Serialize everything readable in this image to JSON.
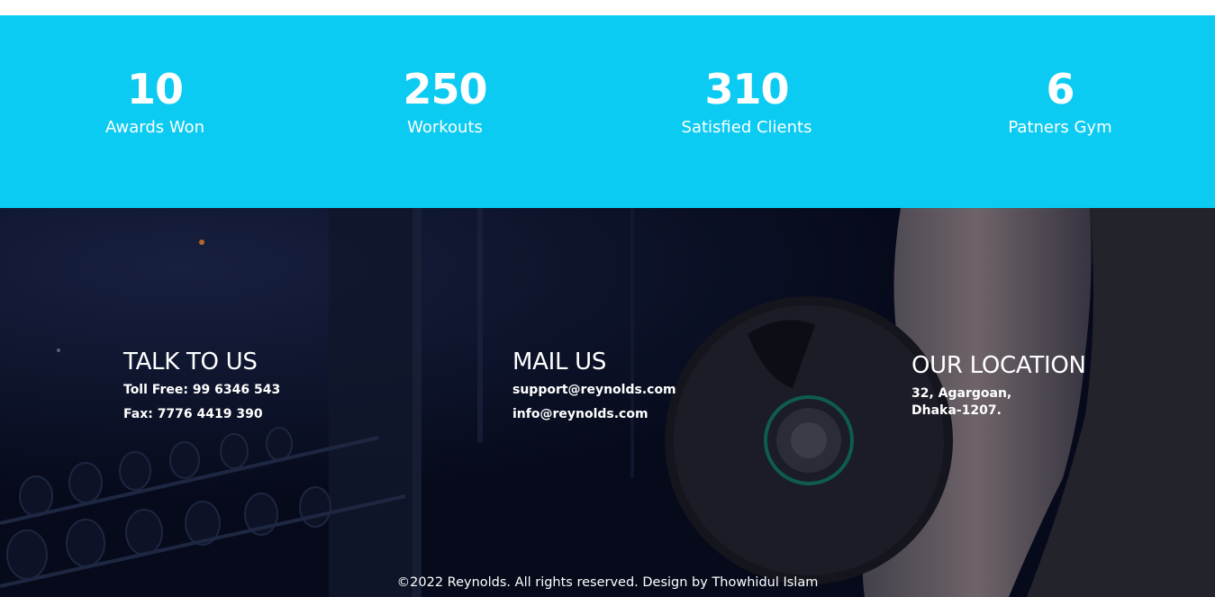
{
  "stats": [
    {
      "value": "10",
      "label": "Awards Won"
    },
    {
      "value": "250",
      "label": "Workouts"
    },
    {
      "value": "310",
      "label": "Satisfied Clients"
    },
    {
      "value": "6",
      "label": "Patners Gym"
    }
  ],
  "footer": {
    "talk": {
      "title": "TALK TO US",
      "toll_free": "Toll Free: 99 6346 543",
      "fax": "Fax: 7776 4419 390"
    },
    "mail": {
      "title": "MAIL US",
      "support": "support@reynolds.com",
      "info": "info@reynolds.com"
    },
    "location": {
      "title": "OUR LOCATION",
      "line1": "32, Agargoan,",
      "line2": "Dhaka-1207."
    },
    "copyright": "©2022 Reynolds. All rights reserved. Design by Thowhidul Islam"
  },
  "colors": {
    "stats_bg": "#0ccbf2",
    "footer_bg": "#070b1d",
    "text": "#ffffff"
  }
}
